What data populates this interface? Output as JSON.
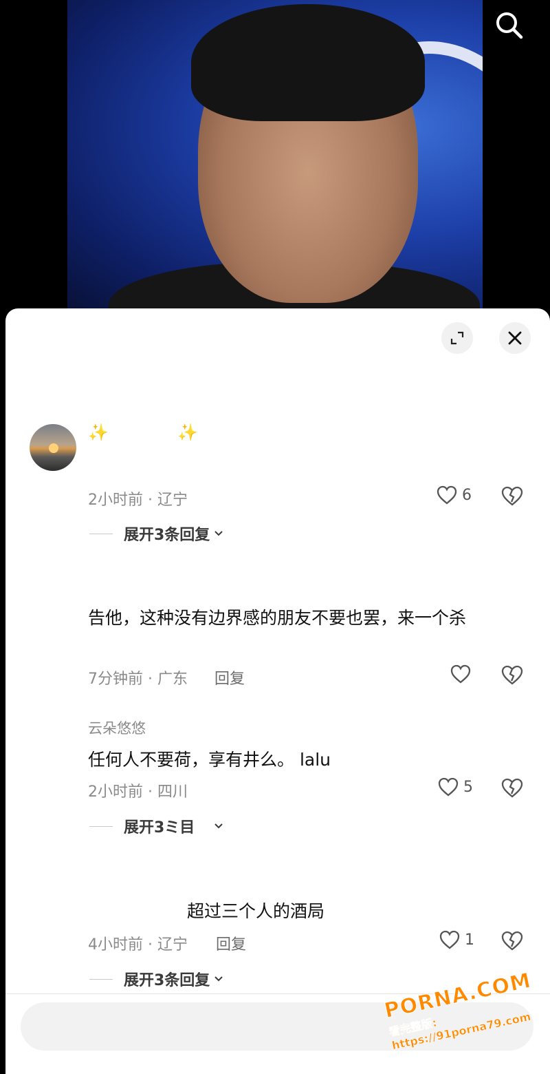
{
  "search": {
    "icon": "search-icon"
  },
  "sheet": {
    "expand_icon": "expand-icon",
    "close_icon": "close-icon"
  },
  "comments": [
    {
      "text": "",
      "sparkle_left": "✨",
      "sparkle_right": "✨",
      "meta": "2小时前 · 辽宁",
      "likes": "6",
      "expand_label": "展开3条回复"
    },
    {
      "text": "告他，这种没有边界感的朋友不要也罢，来一个杀",
      "meta": "7分钟前 · 广东",
      "reply_label": "回复"
    },
    {
      "username": "云朵悠悠",
      "text": "任何人不要荷，享有井么。 lalu",
      "meta": "2小时前 · 四川",
      "likes": "5",
      "expand_label": "展开3ミ目"
    },
    {
      "text": "超过三个人的酒局",
      "meta": "4小时前 · 辽宁",
      "reply_label": "回复",
      "likes": "1",
      "expand_label": "展开3条回复"
    }
  ],
  "watermark": {
    "brand": "PORNA.COM",
    "sub": "看完整版: https://91porna79.com"
  }
}
